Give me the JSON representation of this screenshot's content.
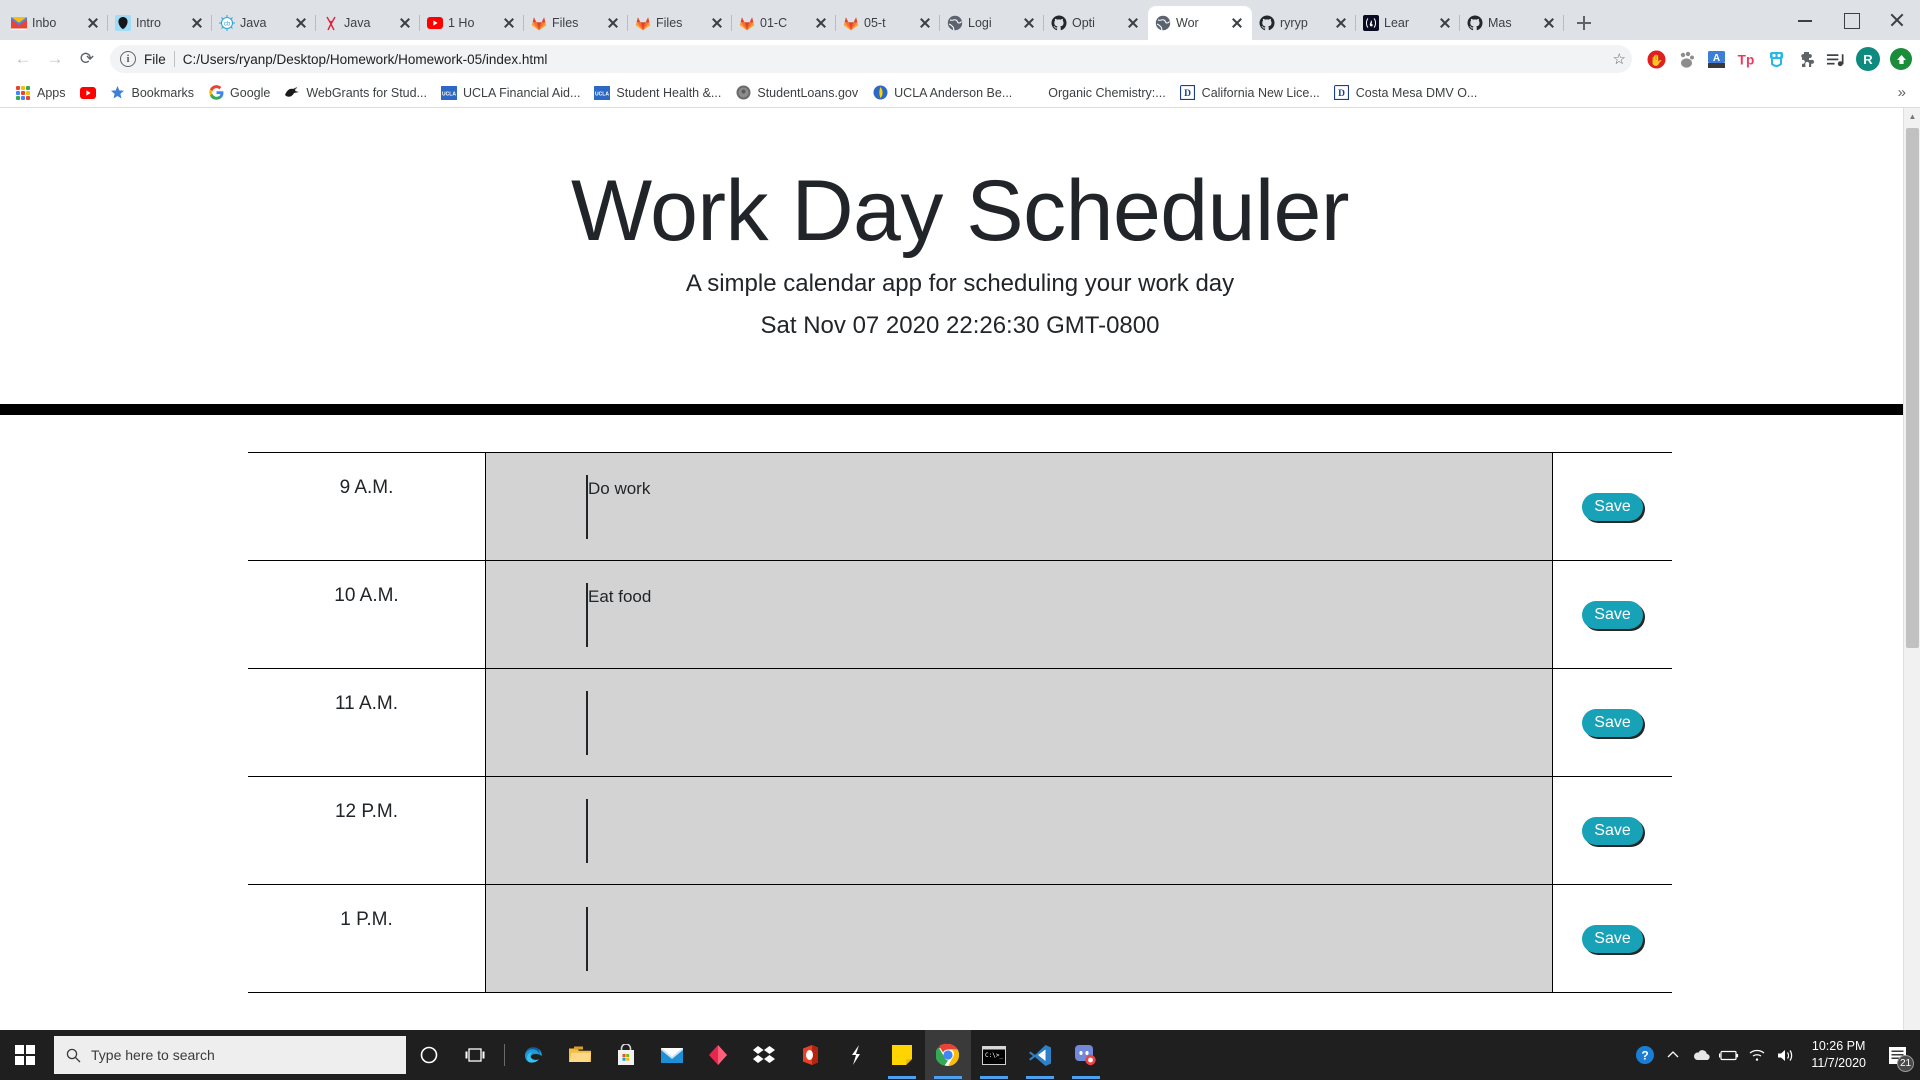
{
  "browser": {
    "tabs": [
      {
        "title": "Inbo",
        "icon": "gmail-icon",
        "active": false
      },
      {
        "title": "Intro",
        "icon": "brand-icon",
        "active": false
      },
      {
        "title": "Java",
        "icon": "codebeat-icon",
        "active": false
      },
      {
        "title": "Java",
        "icon": "antenna-icon",
        "active": false
      },
      {
        "title": "1 Ho",
        "icon": "youtube-icon",
        "active": false
      },
      {
        "title": "Files",
        "icon": "gitlab-icon",
        "active": false
      },
      {
        "title": "Files",
        "icon": "gitlab-icon",
        "active": false
      },
      {
        "title": "01-C",
        "icon": "gitlab-icon",
        "active": false
      },
      {
        "title": "05-t",
        "icon": "gitlab-icon",
        "active": false
      },
      {
        "title": "Logi",
        "icon": "globe-icon",
        "active": false
      },
      {
        "title": "Opti",
        "icon": "github-icon",
        "active": false
      },
      {
        "title": "Wor",
        "icon": "globe-icon",
        "active": true
      },
      {
        "title": "ryryp",
        "icon": "github-icon",
        "active": false
      },
      {
        "title": "Lear",
        "icon": "freecodecamp-icon",
        "active": false
      },
      {
        "title": "Mas",
        "icon": "github-icon",
        "active": false
      }
    ],
    "new_tab_label": "+",
    "window_controls": {
      "minimize": "minimize-button",
      "maximize": "maximize-button",
      "close": "close-button"
    },
    "toolbar": {
      "back": "←",
      "forward": "→",
      "reload": "⟳",
      "info_glyph": "i",
      "scheme_label": "File",
      "url": "C:/Users/ryanp/Desktop/Homework/Homework-05/index.html",
      "star": "☆",
      "extensions": [
        {
          "name": "adblock-icon",
          "glyph": "✋",
          "color": "#e02020"
        },
        {
          "name": "bear-paw-icon",
          "glyph": "🐾",
          "color": "#8d8d8d"
        },
        {
          "name": "grammar-icon",
          "glyph": "A",
          "color": "#3d7fd6"
        },
        {
          "name": "teachers-pay-teachers-icon",
          "glyph": "Tp",
          "color": "#f0385c"
        },
        {
          "name": "owl-icon",
          "glyph": "◑",
          "color": "#28b8e8"
        },
        {
          "name": "puzzle-icon",
          "glyph": "❖",
          "color": "#5f6368"
        },
        {
          "name": "playlist-icon",
          "glyph": "♫",
          "color": "#3c4043"
        }
      ],
      "profile_initial": "R",
      "update_glyph": "⬆"
    },
    "bookmarks": [
      {
        "label": "Apps",
        "icon": "apps-grid-icon"
      },
      {
        "label": "",
        "icon": "youtube-icon"
      },
      {
        "label": "Bookmarks",
        "icon": "star-blue-icon"
      },
      {
        "label": "Google",
        "icon": "google-icon"
      },
      {
        "label": "WebGrants for Stud...",
        "icon": "webgrants-icon"
      },
      {
        "label": "UCLA Financial Aid...",
        "icon": "ucla-icon"
      },
      {
        "label": "Student Health &...",
        "icon": "ucla-icon"
      },
      {
        "label": "StudentLoans.gov",
        "icon": "seal-icon"
      },
      {
        "label": "UCLA Anderson Be...",
        "icon": "anderson-icon"
      },
      {
        "label": "Organic Chemistry:...",
        "icon": "none-icon"
      },
      {
        "label": "California New Lice...",
        "icon": "dmv-icon"
      },
      {
        "label": "Costa Mesa DMV O...",
        "icon": "dmv-icon"
      }
    ],
    "bookmarks_overflow": "»"
  },
  "page": {
    "title": "Work Day Scheduler",
    "subtitle": "A simple calendar app for scheduling your work day",
    "current_date": "Sat Nov 07 2020 22:26:30 GMT-0800",
    "save_label": "Save",
    "accent_color": "#17a2b8",
    "block_color": "#d3d3d3",
    "blocks": [
      {
        "hour": "9 A.M.",
        "text": "Do work"
      },
      {
        "hour": "10 A.M.",
        "text": "Eat food"
      },
      {
        "hour": "11 A.M.",
        "text": ""
      },
      {
        "hour": "12 P.M.",
        "text": ""
      },
      {
        "hour": "1 P.M.",
        "text": ""
      }
    ],
    "scrollbar": {
      "up_arrow": "▲"
    }
  },
  "taskbar": {
    "search_placeholder": "Type here to search",
    "search_icon": "search-icon",
    "start_icon": "windows-start-icon",
    "items": [
      {
        "name": "cortana-icon",
        "glyph": "◯",
        "color": "#ffffff",
        "running": false
      },
      {
        "name": "task-view-icon",
        "glyph": "⧉",
        "color": "#ffffff",
        "running": false
      },
      {
        "name": "edge-icon",
        "glyph": "◔",
        "color": "#2ea5d8",
        "running": false
      },
      {
        "name": "file-explorer-icon",
        "glyph": "🗀",
        "color": "#f5bc42",
        "running": false
      },
      {
        "name": "microsoft-store-icon",
        "glyph": "🛍",
        "color": "#e8e8e8",
        "running": false
      },
      {
        "name": "mail-icon",
        "glyph": "✉",
        "color": "#1e8fd5",
        "running": false
      },
      {
        "name": "unity-hub-icon",
        "glyph": "◆",
        "color": "#e8254a",
        "running": false
      },
      {
        "name": "dropbox-icon",
        "glyph": "❖",
        "color": "#ffffff",
        "running": false
      },
      {
        "name": "office-icon",
        "glyph": "◗",
        "color": "#e8412a",
        "running": false
      },
      {
        "name": "slack-shortcut-icon",
        "glyph": "ᴰ",
        "color": "#ffffff",
        "running": false
      },
      {
        "name": "sticky-notes-icon",
        "glyph": "■",
        "color": "#ffd400",
        "running": true
      },
      {
        "name": "chrome-icon",
        "glyph": "◉",
        "color": "#4285f4",
        "running": true,
        "active": true
      },
      {
        "name": "terminal-icon",
        "glyph": "▰",
        "color": "#000000",
        "running": true
      },
      {
        "name": "vscode-icon",
        "glyph": "✕",
        "color": "#2f80c7",
        "running": true
      },
      {
        "name": "discord-icon",
        "glyph": "◑",
        "color": "#7289da",
        "running": true
      }
    ],
    "tray": [
      {
        "name": "help-icon",
        "glyph": "?"
      },
      {
        "name": "show-hidden-icons-icon",
        "glyph": "⌃"
      },
      {
        "name": "onedrive-icon",
        "glyph": "☁"
      },
      {
        "name": "battery-icon",
        "glyph": "▭"
      },
      {
        "name": "wifi-icon",
        "glyph": "◠"
      },
      {
        "name": "volume-icon",
        "glyph": "🔊"
      }
    ],
    "clock_time": "10:26 PM",
    "clock_date": "11/7/2020",
    "notification_count": "21",
    "notification_icon": "action-center-icon"
  }
}
